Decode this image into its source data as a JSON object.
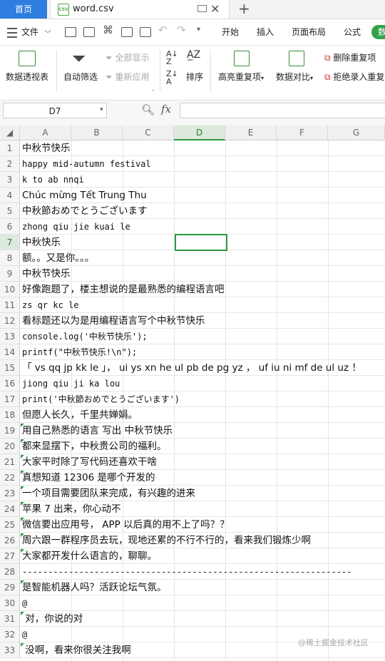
{
  "tabs": {
    "home": "首页",
    "file": "word.csv",
    "file_icon": "CSV"
  },
  "toolbar": {
    "file_menu": "文件",
    "menu_tabs": [
      "开始",
      "插入",
      "页面布局",
      "公式"
    ],
    "badge": "数"
  },
  "ribbon": {
    "pivot": "数据透视表",
    "autofilter": "自动筛选",
    "show_all": "全部显示",
    "reapply": "重新应用",
    "sort": "排序",
    "highlight_dup": "高亮重复项",
    "data_compare": "数据对比",
    "remove_dup": "删除重复项",
    "reject_dup": "拒绝录入重复"
  },
  "formula_bar": {
    "name_box": "D7",
    "fx": "fx"
  },
  "columns": [
    "A",
    "B",
    "C",
    "D",
    "E",
    "F",
    "G"
  ],
  "selected_cell": "D7",
  "rows": [
    {
      "n": "1",
      "text": "中秋节快乐"
    },
    {
      "n": "2",
      "text": "happy mid-autumn festival"
    },
    {
      "n": "3",
      "text": "k to ab nnqi"
    },
    {
      "n": "4",
      "text": "Chúc mừng Tết Trung Thu"
    },
    {
      "n": "5",
      "text": "中秋節おめでとうございます"
    },
    {
      "n": "6",
      "text": "zhong qiu jie kuai le"
    },
    {
      "n": "7",
      "text": "中秋快乐"
    },
    {
      "n": "8",
      "text": "额。。又是你。。。"
    },
    {
      "n": "9",
      "text": "中秋节快乐"
    },
    {
      "n": "10",
      "text": "好像跑题了，楼主想说的是最熟悉的编程语言吧"
    },
    {
      "n": "11",
      "text": "zs qr kc le"
    },
    {
      "n": "12",
      "text": "看标题还以为是用编程语言写个中秋节快乐"
    },
    {
      "n": "13",
      "text": "console.log('中秋节快乐');"
    },
    {
      "n": "14",
      "text": "printf(\"中秋节快乐!\\n\");"
    },
    {
      "n": "15",
      "text": "「 vs qq jp kk le 」， ui ys xn he ul pb de pg yz ， uf iu ni mf de ul uz ！"
    },
    {
      "n": "16",
      "text": "jiong qiu ji ka lou"
    },
    {
      "n": "17",
      "text": "print('中秋節おめでとうございます')"
    },
    {
      "n": "18",
      "text": "但愿人长久，千里共婵娟。"
    },
    {
      "n": "19",
      "text": "用自己熟悉的语言 写出 中秋节快乐"
    },
    {
      "n": "20",
      "text": "都来显摆下，中秋贵公司的福利。"
    },
    {
      "n": "21",
      "text": "大家平时除了写代码还喜欢干啥"
    },
    {
      "n": "22",
      "text": "真想知道 12306 是哪个开发的"
    },
    {
      "n": "23",
      "text": "一个项目需要团队来完成，有兴趣的进来"
    },
    {
      "n": "24",
      "text": "苹果 7 出来，你心动不"
    },
    {
      "n": "25",
      "text": "微信要出应用号， APP 以后真的用不上了吗？？"
    },
    {
      "n": "26",
      "text": "周六跟一群程序员去玩，现地还累的不行不行的，看来我们锻炼少啊"
    },
    {
      "n": "27",
      "text": "大家都开发什么语言的，聊聊。"
    },
    {
      "n": "28",
      "text": "----------------------------------------------------------------"
    },
    {
      "n": "29",
      "text": "是智能机器人吗？活跃论坛气氛。"
    },
    {
      "n": "30",
      "text": "@"
    },
    {
      "n": "31",
      "text": " 对，你说的对"
    },
    {
      "n": "32",
      "text": "@"
    },
    {
      "n": "33",
      "text": " 没啊，看来你很关注我啊"
    }
  ],
  "watermark": "@稀土掘金技术社区"
}
